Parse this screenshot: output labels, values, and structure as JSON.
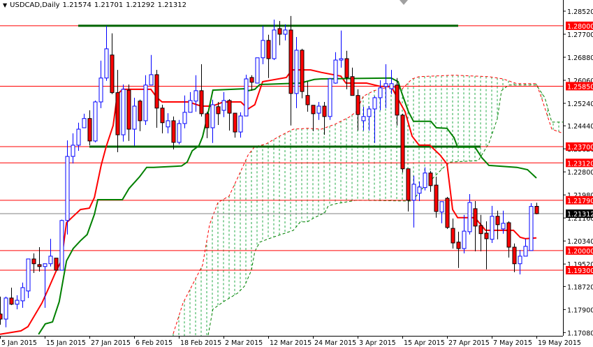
{
  "header": {
    "menu_icon": "triangle-down-icon",
    "symbol": "USDCAD,Daily",
    "open": "1.21574",
    "high": "1.21701",
    "low": "1.21292",
    "close": "1.21312"
  },
  "colors": {
    "bull": "#0000ff",
    "bear": "#ff0000",
    "tenkan": "#ff0000",
    "kijun": "#008000",
    "level": "#ff0000",
    "trendline": "#006400",
    "cloud": "#22aa44",
    "current": "#808080"
  },
  "chart_data": {
    "type": "candlestick",
    "title": "USDCAD,Daily",
    "ylim": [
      1.1695,
      1.2892
    ],
    "y_ticks": [
      "1.28520",
      "1.27700",
      "1.26880",
      "1.26060",
      "1.25240",
      "1.24440",
      "1.23620",
      "1.22800",
      "1.21980",
      "1.21160",
      "1.20340",
      "1.19520",
      "1.18720",
      "1.17900",
      "1.17080"
    ],
    "x_ticks": [
      {
        "bar": 0,
        "label": "5 Jan 2015"
      },
      {
        "bar": 8,
        "label": "15 Jan 2015"
      },
      {
        "bar": 16,
        "label": "27 Jan 2015"
      },
      {
        "bar": 24,
        "label": "6 Feb 2015"
      },
      {
        "bar": 32,
        "label": "18 Feb 2015"
      },
      {
        "bar": 40,
        "label": "2 Mar 2015"
      },
      {
        "bar": 48,
        "label": "12 Mar 2015"
      },
      {
        "bar": 56,
        "label": "24 Mar 2015"
      },
      {
        "bar": 64,
        "label": "3 Apr 2015"
      },
      {
        "bar": 72,
        "label": "15 Apr 2015"
      },
      {
        "bar": 80,
        "label": "27 Apr 2015"
      },
      {
        "bar": 88,
        "label": "7 May 2015"
      },
      {
        "bar": 96,
        "label": "19 May 2015"
      }
    ],
    "ohlc": [
      [
        1.1774,
        1.1836,
        1.1736,
        1.1756
      ],
      [
        1.1756,
        1.1836,
        1.1727,
        1.1831
      ],
      [
        1.1831,
        1.1868,
        1.1806,
        1.1809
      ],
      [
        1.1809,
        1.1841,
        1.1791,
        1.1823
      ],
      [
        1.1821,
        1.1886,
        1.1796,
        1.1868
      ],
      [
        1.1856,
        1.197,
        1.1831,
        1.197
      ],
      [
        1.197,
        1.199,
        1.192,
        1.1953
      ],
      [
        1.195,
        1.2012,
        1.1925,
        1.1943
      ],
      [
        1.1943,
        1.1953,
        1.1796,
        1.1953
      ],
      [
        1.1953,
        1.2042,
        1.1943,
        1.198
      ],
      [
        1.1973,
        1.1973,
        1.193,
        1.193
      ],
      [
        1.193,
        1.211,
        1.193,
        1.2107
      ],
      [
        1.2107,
        1.2392,
        1.2057,
        1.2335
      ],
      [
        1.2335,
        1.2417,
        1.231,
        1.2375
      ],
      [
        1.2375,
        1.2455,
        1.2355,
        1.2432
      ],
      [
        1.2437,
        1.2487,
        1.2437,
        1.247
      ],
      [
        1.247,
        1.2499,
        1.2375,
        1.239
      ],
      [
        1.239,
        1.2534,
        1.2385,
        1.2529
      ],
      [
        1.2529,
        1.2676,
        1.2507,
        1.2614
      ],
      [
        1.2614,
        1.28,
        1.2604,
        1.2718
      ],
      [
        1.2696,
        1.2773,
        1.2557,
        1.2562
      ],
      [
        1.2562,
        1.2643,
        1.235,
        1.2412
      ],
      [
        1.2412,
        1.2591,
        1.2388,
        1.2574
      ],
      [
        1.2571,
        1.2591,
        1.239,
        1.2432
      ],
      [
        1.2432,
        1.2544,
        1.2373,
        1.2514
      ],
      [
        1.2532,
        1.2537,
        1.2425,
        1.2462
      ],
      [
        1.2462,
        1.2624,
        1.2447,
        1.2589
      ],
      [
        1.2589,
        1.2696,
        1.2589,
        1.2626
      ],
      [
        1.2626,
        1.2643,
        1.2437,
        1.2507
      ],
      [
        1.2507,
        1.2519,
        1.2417,
        1.2455
      ],
      [
        1.244,
        1.2489,
        1.2417,
        1.2462
      ],
      [
        1.2462,
        1.2477,
        1.236,
        1.2385
      ],
      [
        1.2385,
        1.2465,
        1.2378,
        1.2452
      ],
      [
        1.2452,
        1.2552,
        1.2435,
        1.2492
      ],
      [
        1.2492,
        1.2564,
        1.2492,
        1.2534
      ],
      [
        1.2532,
        1.2624,
        1.2494,
        1.2569
      ],
      [
        1.2569,
        1.2663,
        1.2477,
        1.2487
      ],
      [
        1.2487,
        1.2494,
        1.24,
        1.2437
      ],
      [
        1.2437,
        1.2537,
        1.2383,
        1.2519
      ],
      [
        1.2512,
        1.2529,
        1.2447,
        1.2487
      ],
      [
        1.2499,
        1.2564,
        1.2475,
        1.2534
      ],
      [
        1.2534,
        1.2539,
        1.2427,
        1.2489
      ],
      [
        1.2489,
        1.2489,
        1.2402,
        1.2422
      ],
      [
        1.2422,
        1.2492,
        1.2402,
        1.2479
      ],
      [
        1.2479,
        1.2626,
        1.2479,
        1.2611
      ],
      [
        1.2616,
        1.2624,
        1.2569,
        1.2599
      ],
      [
        1.2596,
        1.2686,
        1.2596,
        1.2686
      ],
      [
        1.2686,
        1.28,
        1.2663,
        1.2748
      ],
      [
        1.2748,
        1.2768,
        1.2614,
        1.2683
      ],
      [
        1.2683,
        1.2822,
        1.2678,
        1.2785
      ],
      [
        1.279,
        1.2817,
        1.2731,
        1.277
      ],
      [
        1.277,
        1.2805,
        1.2748,
        1.2785
      ],
      [
        1.2785,
        1.2835,
        1.2445,
        1.2559
      ],
      [
        1.2559,
        1.276,
        1.2507,
        1.2713
      ],
      [
        1.2713,
        1.2718,
        1.2542,
        1.2566
      ],
      [
        1.2552,
        1.2601,
        1.2494,
        1.2519
      ],
      [
        1.2517,
        1.2517,
        1.2425,
        1.2487
      ],
      [
        1.2489,
        1.2529,
        1.2465,
        1.2514
      ],
      [
        1.2514,
        1.2529,
        1.2412,
        1.2477
      ],
      [
        1.2477,
        1.2614,
        1.2465,
        1.2611
      ],
      [
        1.2596,
        1.2706,
        1.2594,
        1.2678
      ],
      [
        1.2678,
        1.2783,
        1.2651,
        1.2683
      ],
      [
        1.2683,
        1.2711,
        1.2574,
        1.2616
      ],
      [
        1.2619,
        1.2651,
        1.2552,
        1.2552
      ],
      [
        1.2552,
        1.2574,
        1.2427,
        1.2484
      ],
      [
        1.2462,
        1.2512,
        1.2427,
        1.2477
      ],
      [
        1.2477,
        1.2514,
        1.2427,
        1.2504
      ],
      [
        1.2504,
        1.2549,
        1.2383,
        1.2544
      ],
      [
        1.2544,
        1.2606,
        1.2499,
        1.2579
      ],
      [
        1.2584,
        1.2663,
        1.2507,
        1.2594
      ],
      [
        1.2576,
        1.2643,
        1.2557,
        1.2594
      ],
      [
        1.2589,
        1.2614,
        1.2445,
        1.2482
      ],
      [
        1.2482,
        1.2487,
        1.2278,
        1.2291
      ],
      [
        1.2291,
        1.2291,
        1.2139,
        1.2179
      ],
      [
        1.2179,
        1.2266,
        1.2082,
        1.2236
      ],
      [
        1.2204,
        1.2246,
        1.2176,
        1.2226
      ],
      [
        1.2224,
        1.2296,
        1.2214,
        1.2276
      ],
      [
        1.2276,
        1.2283,
        1.2209,
        1.2231
      ],
      [
        1.2233,
        1.2263,
        1.2117,
        1.2139
      ],
      [
        1.2137,
        1.2174,
        1.2097,
        1.2174
      ],
      [
        1.2186,
        1.2191,
        1.2077,
        1.2082
      ],
      [
        1.2079,
        1.2114,
        1.2007,
        1.2027
      ],
      [
        1.203,
        1.2067,
        1.1938,
        1.2007
      ],
      [
        1.2007,
        1.2127,
        1.199,
        1.2069
      ],
      [
        1.2067,
        1.2201,
        1.2057,
        1.2171
      ],
      [
        1.2149,
        1.2176,
        1.1997,
        1.2087
      ],
      [
        1.2089,
        1.2127,
        1.1997,
        1.206
      ],
      [
        1.2062,
        1.2104,
        1.1933,
        1.2042
      ],
      [
        1.204,
        1.2159,
        1.2027,
        1.2122
      ],
      [
        1.2122,
        1.2142,
        1.204,
        1.2092
      ],
      [
        1.2077,
        1.2142,
        1.206,
        1.2097
      ],
      [
        1.2099,
        1.2104,
        1.1975,
        1.2012
      ],
      [
        1.2012,
        1.2025,
        1.1923,
        1.1953
      ],
      [
        1.1953,
        1.2002,
        1.1915,
        1.198
      ],
      [
        1.198,
        1.2042,
        1.198,
        1.2015
      ],
      [
        1.2,
        1.2169,
        1.2,
        1.2157
      ],
      [
        1.21574,
        1.21701,
        1.21292,
        1.21312
      ]
    ],
    "tenkan": [
      [
        0,
        1.1702
      ],
      [
        3.75,
        1.1714
      ],
      [
        5,
        1.1729
      ],
      [
        6.25,
        1.1771
      ],
      [
        7.5,
        1.1813
      ],
      [
        8.75,
        1.1868
      ],
      [
        10,
        1.1925
      ],
      [
        11,
        1.1965
      ],
      [
        11.9,
        1.2099
      ],
      [
        13.1,
        1.2122
      ],
      [
        14.4,
        1.2146
      ],
      [
        16,
        1.2151
      ],
      [
        16.9,
        1.2189
      ],
      [
        18.1,
        1.2303
      ],
      [
        19,
        1.237
      ],
      [
        20.25,
        1.2445
      ],
      [
        21,
        1.2557
      ],
      [
        22,
        1.2574
      ],
      [
        27,
        1.2574
      ],
      [
        28.1,
        1.2544
      ],
      [
        29,
        1.2529
      ],
      [
        33.75,
        1.2529
      ],
      [
        36,
        1.2514
      ],
      [
        38,
        1.2514
      ],
      [
        40,
        1.2529
      ],
      [
        43.1,
        1.2529
      ],
      [
        44.4,
        1.2504
      ],
      [
        45.6,
        1.2519
      ],
      [
        47,
        1.2601
      ],
      [
        51.25,
        1.2616
      ],
      [
        52.25,
        1.2643
      ],
      [
        55.6,
        1.2643
      ],
      [
        57.5,
        1.2634
      ],
      [
        61,
        1.2621
      ],
      [
        61.9,
        1.2596
      ],
      [
        65.6,
        1.2596
      ],
      [
        68.1,
        1.2584
      ],
      [
        70,
        1.2584
      ],
      [
        71.25,
        1.2539
      ],
      [
        72.5,
        1.2494
      ],
      [
        73.75,
        1.2407
      ],
      [
        75,
        1.2375
      ],
      [
        76.9,
        1.2375
      ],
      [
        78.75,
        1.234
      ],
      [
        80,
        1.2308
      ],
      [
        81,
        1.2146
      ],
      [
        81.9,
        1.2117
      ],
      [
        85,
        1.2117
      ],
      [
        86.9,
        1.2072
      ],
      [
        91.9,
        1.2072
      ],
      [
        93.1,
        1.2047
      ],
      [
        94,
        1.2042
      ],
      [
        96,
        1.2045
      ]
    ],
    "kijun": [
      [
        6.9,
        1.1702
      ],
      [
        8.1,
        1.1739
      ],
      [
        9.4,
        1.1746
      ],
      [
        10.6,
        1.1818
      ],
      [
        11.9,
        1.1963
      ],
      [
        13.1,
        1.2007
      ],
      [
        14.4,
        1.2035
      ],
      [
        15.6,
        1.2057
      ],
      [
        16.9,
        1.2129
      ],
      [
        17.5,
        1.2181
      ],
      [
        21.9,
        1.2181
      ],
      [
        23.1,
        1.2221
      ],
      [
        25,
        1.2263
      ],
      [
        26.25,
        1.2296
      ],
      [
        27.5,
        1.2296
      ],
      [
        32.5,
        1.2301
      ],
      [
        33.5,
        1.2315
      ],
      [
        34.4,
        1.2355
      ],
      [
        35.6,
        1.2373
      ],
      [
        36.25,
        1.2405
      ],
      [
        37,
        1.2467
      ],
      [
        38.1,
        1.2571
      ],
      [
        43.75,
        1.2576
      ],
      [
        44.4,
        1.2569
      ],
      [
        45.6,
        1.2574
      ],
      [
        46.5,
        1.2591
      ],
      [
        53.75,
        1.2596
      ],
      [
        56.25,
        1.2609
      ],
      [
        57.5,
        1.2611
      ],
      [
        70,
        1.2614
      ],
      [
        71.25,
        1.2601
      ],
      [
        71.9,
        1.2561
      ],
      [
        73.1,
        1.2494
      ],
      [
        74,
        1.246
      ],
      [
        77.1,
        1.246
      ],
      [
        78.1,
        1.2437
      ],
      [
        80,
        1.2435
      ],
      [
        81.25,
        1.2402
      ],
      [
        81.9,
        1.2368
      ],
      [
        85,
        1.2368
      ],
      [
        86.25,
        1.233
      ],
      [
        87.5,
        1.2303
      ],
      [
        92.5,
        1.2296
      ],
      [
        94.4,
        1.2288
      ],
      [
        96,
        1.2258
      ]
    ],
    "span_a": [
      [
        31,
        1.1704
      ],
      [
        32.75,
        1.1813
      ],
      [
        36.25,
        1.1948
      ],
      [
        37.5,
        1.2092
      ],
      [
        39,
        1.2171
      ],
      [
        41,
        1.2194
      ],
      [
        43.1,
        1.2283
      ],
      [
        44.4,
        1.234
      ],
      [
        45.6,
        1.237
      ],
      [
        47.5,
        1.2378
      ],
      [
        50,
        1.2407
      ],
      [
        52.5,
        1.2432
      ],
      [
        55,
        1.2435
      ],
      [
        57.5,
        1.2432
      ],
      [
        60,
        1.245
      ],
      [
        62.5,
        1.2475
      ],
      [
        63.75,
        1.2494
      ],
      [
        65,
        1.2549
      ],
      [
        66.9,
        1.2569
      ],
      [
        70,
        1.2584
      ],
      [
        71.9,
        1.2574
      ],
      [
        73.75,
        1.2611
      ],
      [
        75,
        1.2619
      ],
      [
        81.25,
        1.2624
      ],
      [
        87.5,
        1.2619
      ],
      [
        90,
        1.2611
      ],
      [
        92.5,
        1.2594
      ],
      [
        96,
        1.2594
      ],
      [
        96.9,
        1.2544
      ],
      [
        98.75,
        1.2432
      ],
      [
        100.75,
        1.2417
      ]
    ],
    "span_b": [
      [
        37.25,
        1.1699
      ],
      [
        38.1,
        1.1791
      ],
      [
        40,
        1.1818
      ],
      [
        42.5,
        1.1848
      ],
      [
        43.75,
        1.1873
      ],
      [
        45,
        1.193
      ],
      [
        45.6,
        1.1997
      ],
      [
        46.5,
        1.203
      ],
      [
        48.1,
        1.2042
      ],
      [
        50,
        1.2055
      ],
      [
        52.5,
        1.2072
      ],
      [
        53.75,
        1.2102
      ],
      [
        55,
        1.2102
      ],
      [
        56.25,
        1.2117
      ],
      [
        58.1,
        1.2134
      ],
      [
        58.75,
        1.2159
      ],
      [
        60,
        1.2166
      ],
      [
        63.75,
        1.2179
      ],
      [
        73.75,
        1.2176
      ],
      [
        75.6,
        1.2221
      ],
      [
        77.5,
        1.2258
      ],
      [
        79.4,
        1.2296
      ],
      [
        80.6,
        1.2315
      ],
      [
        85.6,
        1.232
      ],
      [
        87.5,
        1.2382
      ],
      [
        89,
        1.2469
      ],
      [
        89.75,
        1.2569
      ],
      [
        91,
        1.2589
      ],
      [
        96,
        1.2589
      ],
      [
        97.5,
        1.2544
      ],
      [
        98.75,
        1.2457
      ],
      [
        100.75,
        1.2457
      ]
    ],
    "levels": [
      {
        "price": 1.28,
        "label": "1.28000"
      },
      {
        "price": 1.2585,
        "label": "1.25850"
      },
      {
        "price": 1.237,
        "label": "1.23700"
      },
      {
        "price": 1.2312,
        "label": "1.23120"
      },
      {
        "price": 1.2179,
        "label": "1.21790"
      },
      {
        "price": 1.2,
        "label": "1.20000"
      },
      {
        "price": 1.193,
        "label": "1.19300"
      }
    ],
    "current_price": {
      "price": 1.21312,
      "label": "1.21312"
    },
    "trendlines": [
      {
        "price": 1.28,
        "from_bar": 14,
        "to_bar": 82
      },
      {
        "price": 1.237,
        "from_bar": 16,
        "to_bar": 86
      }
    ]
  }
}
